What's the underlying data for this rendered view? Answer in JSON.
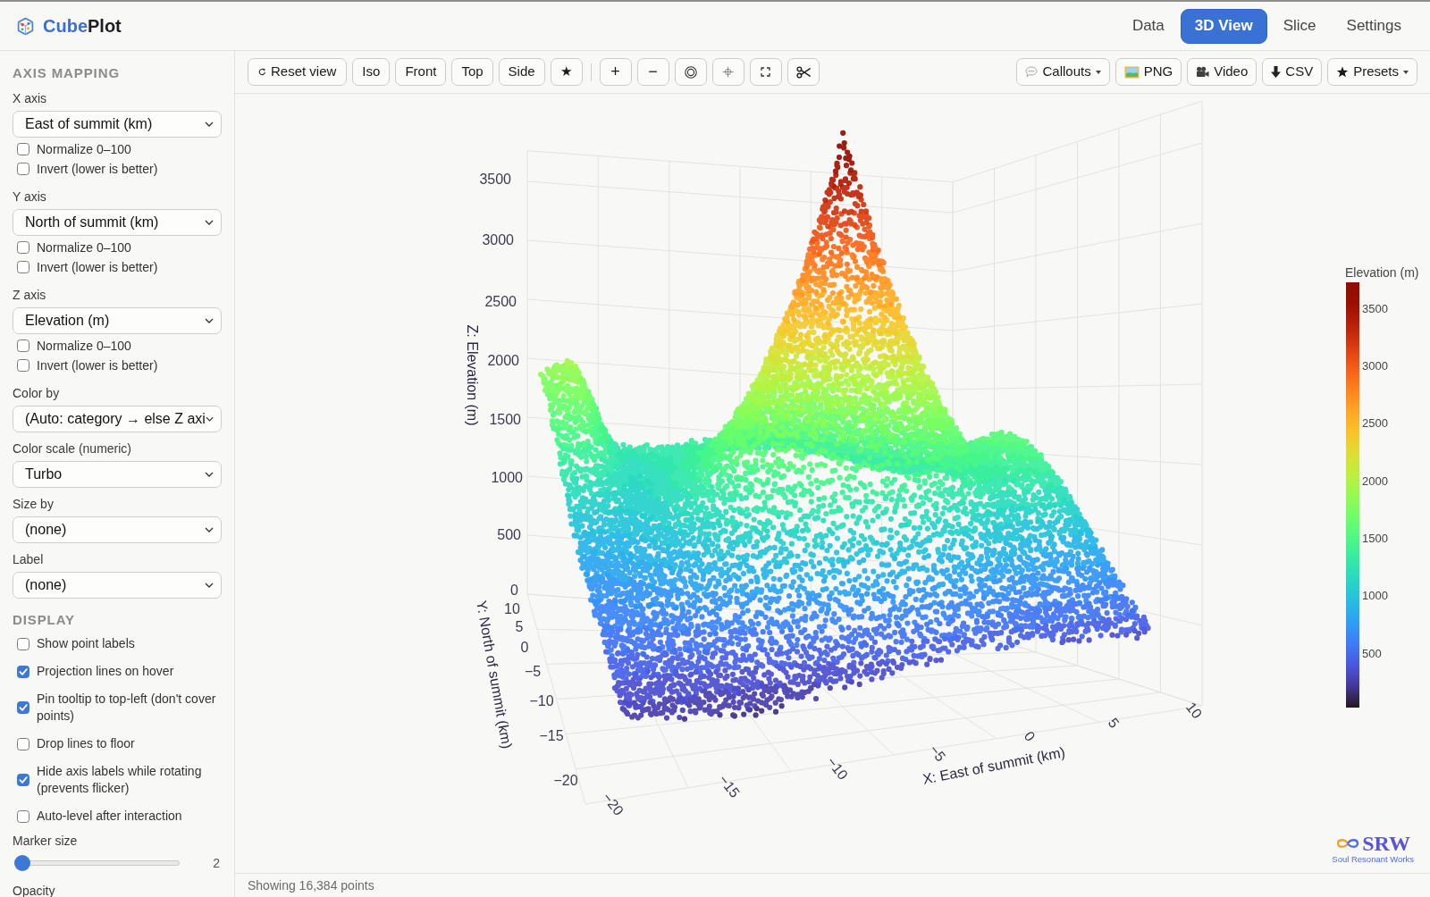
{
  "app": {
    "name_accent": "Cube",
    "name_rest": "Plot"
  },
  "tabs": [
    {
      "label": "Data",
      "selected": false
    },
    {
      "label": "3D View",
      "selected": true
    },
    {
      "label": "Slice",
      "selected": false
    },
    {
      "label": "Settings",
      "selected": false
    }
  ],
  "sidebar": {
    "sections": [
      {
        "title": "AXIS MAPPING",
        "controls": [
          {
            "kind": "select",
            "label": "X axis",
            "value": "East of summit (km)",
            "checkboxes": [
              {
                "label": "Normalize 0–100",
                "checked": false
              },
              {
                "label": "Invert (lower is better)",
                "checked": false
              }
            ]
          },
          {
            "kind": "select",
            "label": "Y axis",
            "value": "North of summit (km)",
            "checkboxes": [
              {
                "label": "Normalize 0–100",
                "checked": false
              },
              {
                "label": "Invert (lower is better)",
                "checked": false
              }
            ]
          },
          {
            "kind": "select",
            "label": "Z axis",
            "value": "Elevation (m)",
            "checkboxes": [
              {
                "label": "Normalize 0–100",
                "checked": false
              },
              {
                "label": "Invert (lower is better)",
                "checked": false
              }
            ]
          },
          {
            "kind": "select",
            "label": "Color by",
            "value": "(Auto: category → else Z axi"
          },
          {
            "kind": "select",
            "label": "Color scale (numeric)",
            "value": "Turbo"
          },
          {
            "kind": "select",
            "label": "Size by",
            "value": "(none)"
          },
          {
            "kind": "select",
            "label": "Label",
            "value": "(none)"
          }
        ]
      },
      {
        "title": "DISPLAY",
        "controls": [
          {
            "kind": "checkbox",
            "label": "Show point labels",
            "checked": false
          },
          {
            "kind": "checkbox",
            "label": "Projection lines on hover",
            "checked": true
          },
          {
            "kind": "checkbox",
            "label": "Pin tooltip to top-left (don't cover points)",
            "checked": true
          },
          {
            "kind": "checkbox",
            "label": "Drop lines to floor",
            "checked": false
          },
          {
            "kind": "checkbox",
            "label": "Hide axis labels while rotating (prevents flicker)",
            "checked": true
          },
          {
            "kind": "checkbox",
            "label": "Auto-level after interaction",
            "checked": false
          },
          {
            "kind": "slider",
            "label": "Marker size",
            "level": 0,
            "reading": "2"
          },
          {
            "kind": "label",
            "label": "Opacity"
          }
        ]
      }
    ]
  },
  "toolbar": {
    "view_buttons": [
      "Reset view",
      "Iso",
      "Front",
      "Top",
      "Side",
      "★"
    ],
    "zoom_buttons": [
      "+",
      "−"
    ],
    "export_buttons": [
      {
        "label": "Callouts",
        "dropdown": true
      },
      {
        "label": "PNG",
        "dropdown": false
      },
      {
        "label": "Video",
        "dropdown": false
      },
      {
        "label": "CSV",
        "dropdown": false
      },
      {
        "label": "Presets",
        "dropdown": true
      }
    ]
  },
  "plot": {
    "z_axis": {
      "title": "Z: Elevation (m)",
      "ticks": [
        "3500",
        "3000",
        "2500",
        "2000",
        "1500",
        "1000",
        "500",
        "0"
      ]
    },
    "y_axis": {
      "title": "Y: North of summit (km)",
      "ticks": [
        "10",
        "5",
        "0",
        "−5",
        "−10",
        "−15",
        "−20"
      ]
    },
    "x_axis": {
      "title": "X: East of summit (km)",
      "ticks": [
        "−20",
        "−15",
        "−10",
        "−5",
        "0",
        "5",
        "10"
      ]
    },
    "colorbar": {
      "title": "Elevation (m)",
      "ticks": [
        "3500",
        "3000",
        "2500",
        "2000",
        "1500",
        "1000",
        "500"
      ]
    }
  },
  "credit": {
    "mark": "SRW",
    "tagline": "Soul Resonant Works"
  },
  "status_bar": {
    "text": "Showing 16,384 points"
  }
}
